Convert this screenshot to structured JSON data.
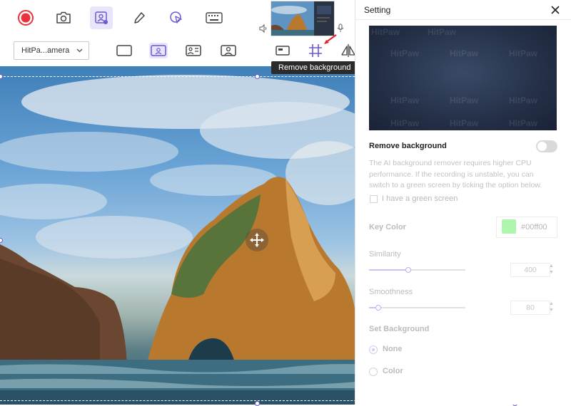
{
  "toolbar": {
    "camera_select_value": "HitPa...amera"
  },
  "tooltip": {
    "text": "Remove background"
  },
  "panel": {
    "title": "Setting",
    "watermark": "HitPaw",
    "remove_background": {
      "label": "Remove background",
      "enabled": false,
      "description": "The AI background remover requires higher CPU performance. If the recording is unstable, you can switch to a green screen by ticking the option below."
    },
    "green_screen": {
      "label": "I have a green screen",
      "checked": false
    },
    "key_color": {
      "label": "Key Color",
      "value": "#00ff00",
      "swatch_color": "#aef5ae"
    },
    "similarity": {
      "label": "Similarity",
      "value": "400"
    },
    "smoothness": {
      "label": "Smoothness",
      "value": "80"
    },
    "set_background": {
      "label": "Set Background",
      "options": [
        {
          "label": "None",
          "selected": true
        },
        {
          "label": "Color",
          "selected": false
        }
      ]
    }
  },
  "icons": {
    "record": "record-icon",
    "screenshot": "camera-icon",
    "webcam": "webcam-icon",
    "pen": "pen-icon",
    "cursor": "cursor-click-icon",
    "keyboard": "keyboard-icon",
    "speaker": "speaker-icon",
    "mic": "microphone-icon",
    "move": "move-icon",
    "close": "close-icon"
  },
  "colors": {
    "accent": "#6a5acd",
    "record": "#e8323c",
    "active_bg": "#e7e4fb"
  }
}
